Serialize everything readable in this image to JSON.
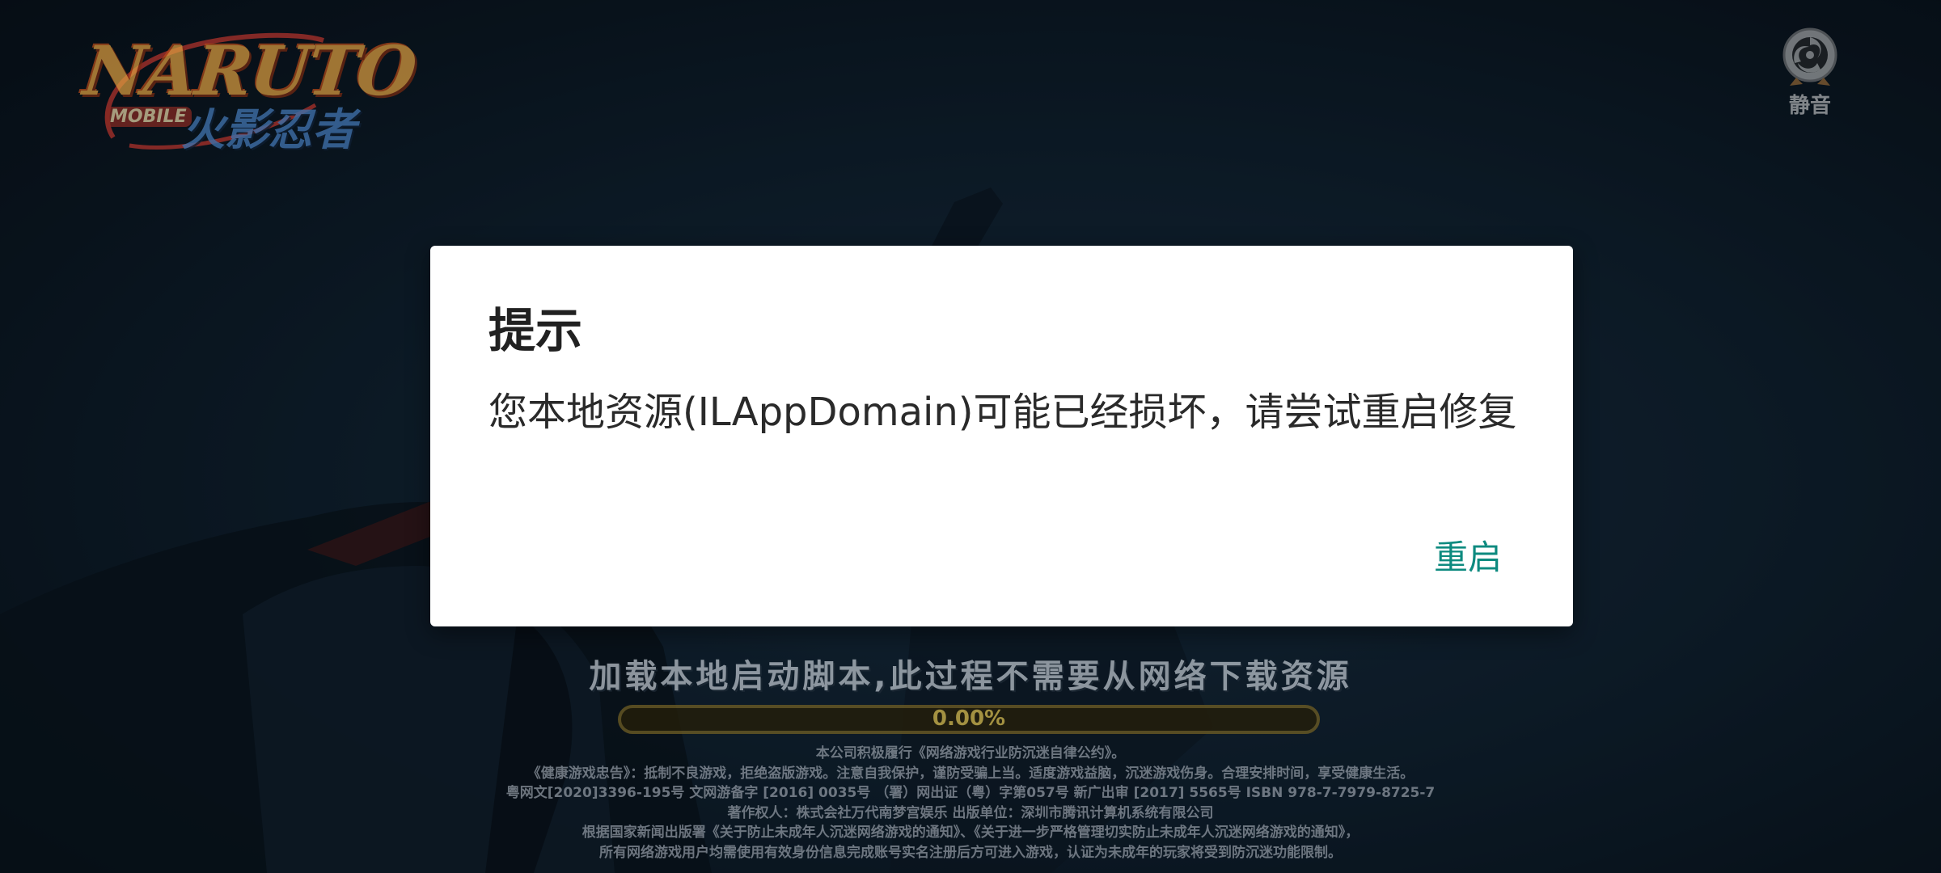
{
  "logo": {
    "main_text": "NARUTO",
    "sub_text": "MOBILE",
    "cn_text": "火影忍者"
  },
  "mute": {
    "label": "静音",
    "icon": "tomoe-icon"
  },
  "loading": {
    "message": "加载本地启动脚本,此过程不需要从网络下载资源",
    "progress_text": "0.00%",
    "progress_fraction": 0.0
  },
  "legal_lines": [
    "本公司积极履行《网络游戏行业防沉迷自律公约》。",
    "《健康游戏忠告》：抵制不良游戏，拒绝盗版游戏。注意自我保护，谨防受骗上当。适度游戏益脑，沉迷游戏伤身。合理安排时间，享受健康生活。",
    "粤网文[2020]3396-195号 文网游备字 [2016] 0035号 （署）网出证（粤）字第057号 新广出审 [2017] 5565号 ISBN 978-7-7979-8725-7",
    "著作权人：株式会社万代南梦宫娱乐 出版单位：深圳市腾讯计算机系统有限公司",
    "根据国家新闻出版署《关于防止未成年人沉迷网络游戏的通知》、《关于进一步严格管理切实防止未成年人沉迷网络游戏的通知》，",
    "所有网络游戏用户均需使用有效身份信息完成账号实名注册后方可进入游戏，认证为未成年的玩家将受到防沉迷功能限制。"
  ],
  "dialog": {
    "title": "提示",
    "message": "您本地资源(ILAppDomain)可能已经损坏，请尝试重启修复",
    "button_label": "重启"
  },
  "colors": {
    "accent": "#0d8a7f",
    "dialog_bg": "#ffffff",
    "scene_bg": "#142a3d"
  }
}
